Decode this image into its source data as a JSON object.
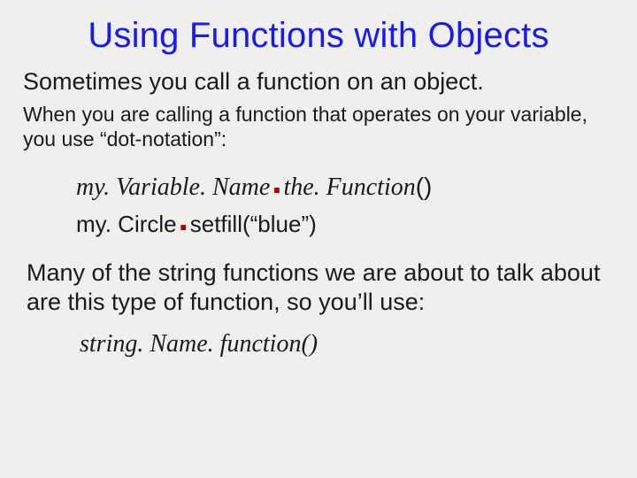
{
  "title": "Using Functions with Objects",
  "lead": "Sometimes you call a function on an object.",
  "sub": "When you are calling a function that operates on your variable, you use “dot-notation”:",
  "code1": {
    "part_a": "my. Variable. Name",
    "part_b": "the. Function",
    "parens": "()"
  },
  "code2": {
    "part_a": "my. Circle",
    "part_b": "setfill(“blue”)"
  },
  "body": "Many of the string functions we are about to talk about are this type of function, so you’ll use:",
  "code3": "string. Name. function()"
}
